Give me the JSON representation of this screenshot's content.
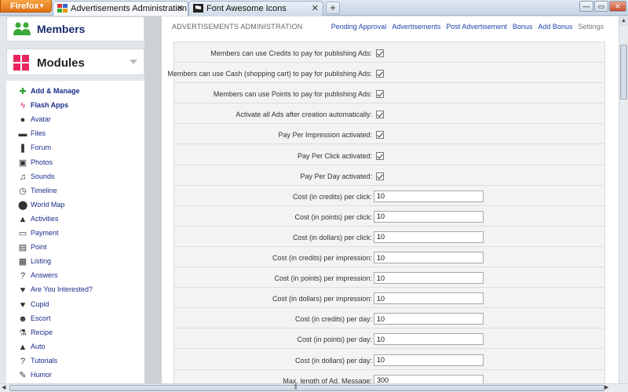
{
  "browser": {
    "menu_button": "Firefox",
    "tabs": [
      {
        "title": "Advertisements Administration",
        "active": true
      },
      {
        "title": "Font Awesome Icons",
        "active": false
      }
    ],
    "new_tab": "+",
    "window_controls": {
      "minimize": "—",
      "maximize": "▭",
      "close": "✕"
    }
  },
  "sidebar": {
    "members_title": "Members",
    "modules_title": "Modules",
    "items": [
      {
        "label": "Add & Manage",
        "icon": "plus-icon",
        "bold": true
      },
      {
        "label": "Flash Apps",
        "icon": "bolt-icon",
        "bold": true
      },
      {
        "label": "Avatar",
        "icon": "user-icon"
      },
      {
        "label": "Files",
        "icon": "folder-icon"
      },
      {
        "label": "Forum",
        "icon": "comments-icon"
      },
      {
        "label": "Photos",
        "icon": "picture-icon"
      },
      {
        "label": "Sounds",
        "icon": "music-icon"
      },
      {
        "label": "Timeline",
        "icon": "clock-icon"
      },
      {
        "label": "World Map",
        "icon": "map-marker-icon"
      },
      {
        "label": "Activities",
        "icon": "road-icon"
      },
      {
        "label": "Payment",
        "icon": "credit-card-icon"
      },
      {
        "label": "Point",
        "icon": "money-icon"
      },
      {
        "label": "Listing",
        "icon": "briefcase-icon"
      },
      {
        "label": "Answers",
        "icon": "question-icon"
      },
      {
        "label": "Are You Interested?",
        "icon": "heart-icon"
      },
      {
        "label": "Cupid",
        "icon": "heart-icon"
      },
      {
        "label": "Escort",
        "icon": "group-icon"
      },
      {
        "label": "Recipe",
        "icon": "beaker-icon"
      },
      {
        "label": "Auto",
        "icon": "road-icon"
      },
      {
        "label": "Tutorials",
        "icon": "question-icon"
      },
      {
        "label": "Humor",
        "icon": "pencil-icon"
      }
    ]
  },
  "main": {
    "page_title": "ADVERTISEMENTS ADMINISTRATION",
    "nav": [
      {
        "label": "Pending Approval",
        "current": false
      },
      {
        "label": "Advertisements",
        "current": false
      },
      {
        "label": "Post Advertisement",
        "current": false
      },
      {
        "label": "Bonus",
        "current": false
      },
      {
        "label": "Add Bonus",
        "current": false
      },
      {
        "label": "Settings",
        "current": true
      }
    ],
    "settings": [
      {
        "label": "Members can use Credits to pay for publishing Ads:",
        "type": "checkbox",
        "checked": true
      },
      {
        "label": "Members can use Cash (shopping cart) to pay for publishing Ads:",
        "type": "checkbox",
        "checked": true
      },
      {
        "label": "Members can use Points to pay for publishing Ads:",
        "type": "checkbox",
        "checked": true
      },
      {
        "label": "Activate all Ads after creation automatically:",
        "type": "checkbox",
        "checked": true
      },
      {
        "label": "Pay Per Impression activated:",
        "type": "checkbox",
        "checked": true
      },
      {
        "label": "Pay Per Click activated:",
        "type": "checkbox",
        "checked": true
      },
      {
        "label": "Pay Per Day activated:",
        "type": "checkbox",
        "checked": true
      },
      {
        "label": "Cost (in credits) per click:",
        "type": "text",
        "value": "10"
      },
      {
        "label": "Cost (in points) per click:",
        "type": "text",
        "value": "10"
      },
      {
        "label": "Cost (in dollars) per click:",
        "type": "text",
        "value": "10"
      },
      {
        "label": "Cost (in credits) per impression:",
        "type": "text",
        "value": "10"
      },
      {
        "label": "Cost (in points) per impression:",
        "type": "text",
        "value": "10"
      },
      {
        "label": "Cost (in dollars) per impression:",
        "type": "text",
        "value": "10"
      },
      {
        "label": "Cost (in credits) per day:",
        "type": "text",
        "value": "10"
      },
      {
        "label": "Cost (in points) per day:",
        "type": "text",
        "value": "10"
      },
      {
        "label": "Cost (in dollars) per day:",
        "type": "text",
        "value": "10"
      },
      {
        "label": "Max. length of Ad. Message:",
        "type": "text",
        "value": "300"
      }
    ]
  },
  "colors": {
    "accent_link": "#2244aa",
    "members_icon": "#3aa935",
    "modules_icon": "#e8265d",
    "firefox_button": "#e87b1c"
  }
}
